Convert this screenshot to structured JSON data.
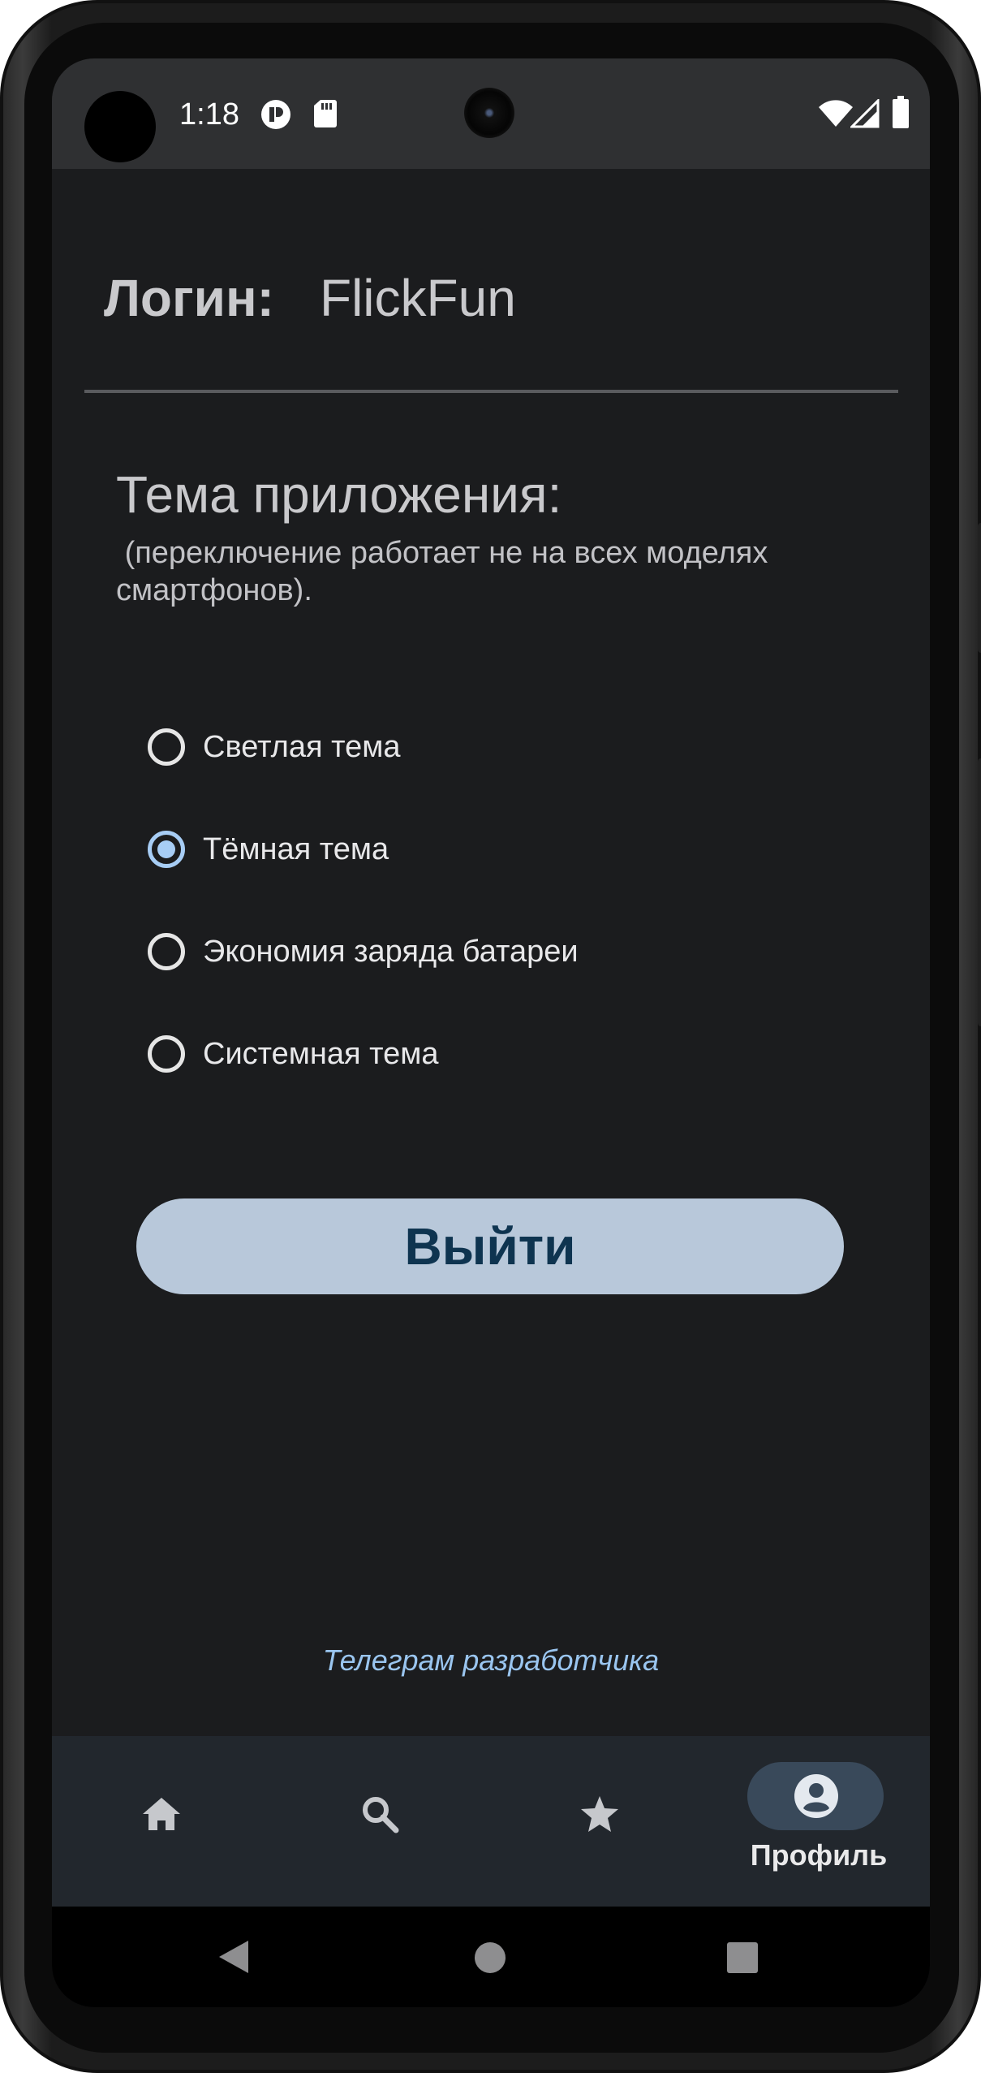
{
  "status_bar": {
    "time": "1:18"
  },
  "profile": {
    "login_label": "Логин:",
    "login_value": "FlickFun"
  },
  "theme": {
    "title": "Тема приложения:",
    "note": " (переключение работает не на всех моделях смартфонов).",
    "options": [
      {
        "label": "Светлая тема",
        "selected": false
      },
      {
        "label": "Тёмная тема",
        "selected": true
      },
      {
        "label": "Экономия заряда батареи",
        "selected": false
      },
      {
        "label": "Системная тема",
        "selected": false
      }
    ]
  },
  "logout_button": "Выйти",
  "developer_link": "Телеграм разработчика",
  "bottom_nav": {
    "items": [
      {
        "icon": "home-icon",
        "label": "",
        "active": false
      },
      {
        "icon": "search-icon",
        "label": "",
        "active": false
      },
      {
        "icon": "star-icon",
        "label": "",
        "active": false
      },
      {
        "icon": "account-circle-icon",
        "label": "Профиль",
        "active": true
      }
    ]
  },
  "colors": {
    "background": "#1b1c1e",
    "accent": "#a7cdf5",
    "button_bg": "#b8c8da",
    "button_text": "#0e3450",
    "link": "#9ac5ef"
  }
}
